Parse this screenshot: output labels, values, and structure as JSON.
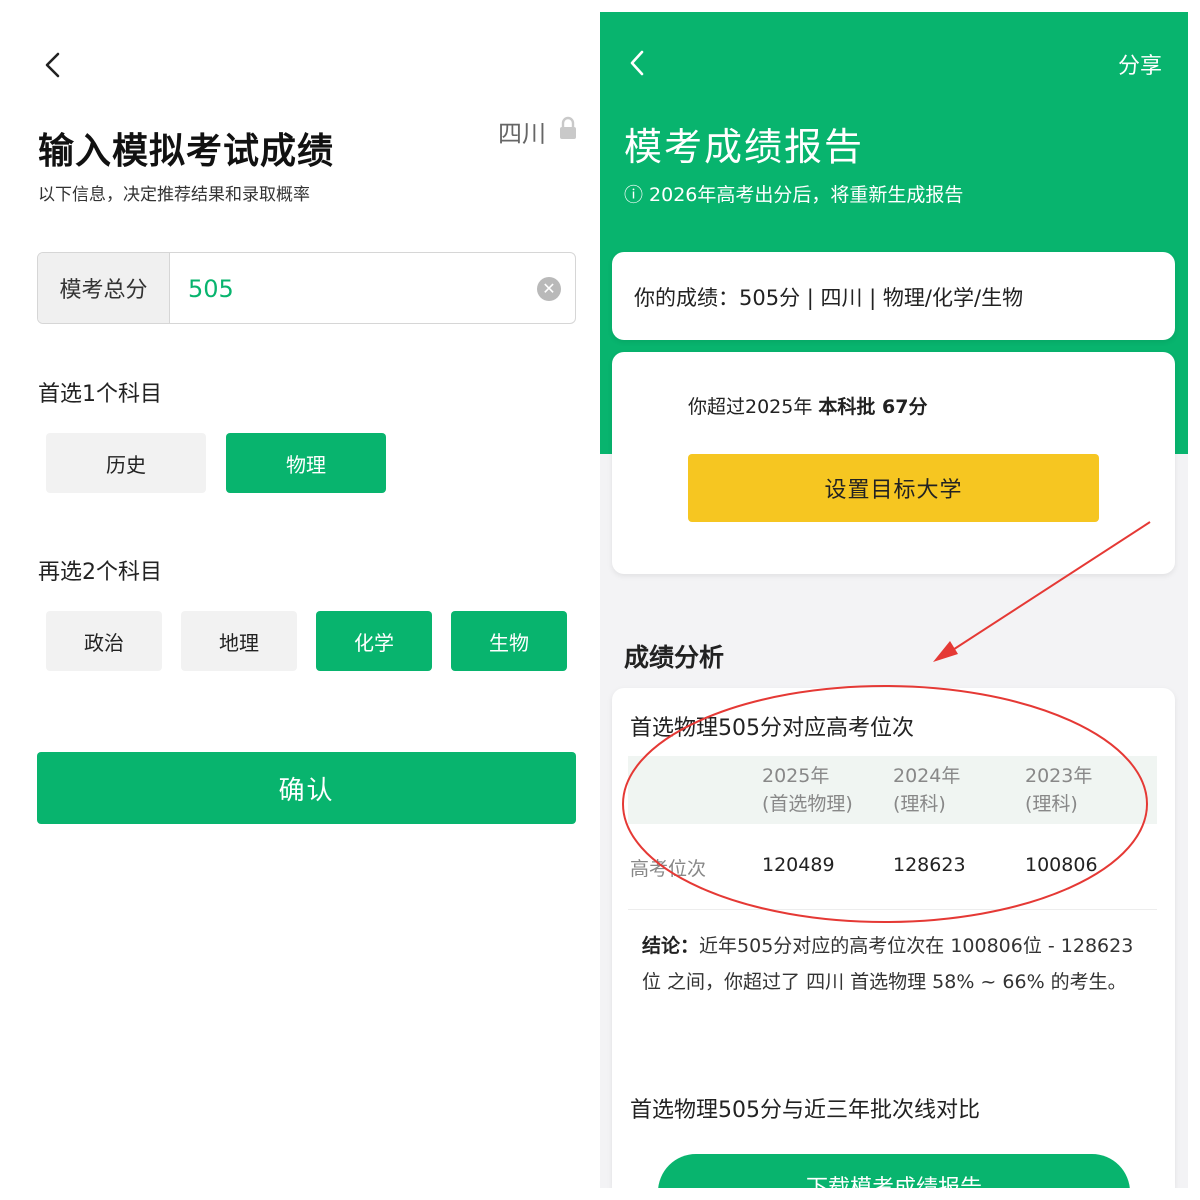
{
  "left": {
    "title": "输入模拟考试成绩",
    "province": "四川",
    "subtitle": "以下信息，决定推荐结果和录取概率",
    "score_label": "模考总分",
    "score_value": "505",
    "primary_label": "首选1个科目",
    "primary_options": [
      {
        "label": "历史",
        "selected": false
      },
      {
        "label": "物理",
        "selected": true
      }
    ],
    "secondary_label": "再选2个科目",
    "secondary_options": [
      {
        "label": "政治",
        "selected": false
      },
      {
        "label": "地理",
        "selected": false
      },
      {
        "label": "化学",
        "selected": true
      },
      {
        "label": "生物",
        "selected": true
      }
    ],
    "confirm_label": "确认"
  },
  "right": {
    "share_label": "分享",
    "title": "模考成绩报告",
    "note": "ⓘ 2026年高考出分后，将重新生成报告",
    "your_score": "你的成绩：505分 | 四川 | 物理/化学/生物",
    "exceed_prefix": "你超过2025年 ",
    "exceed_bold": "本科批 67分",
    "target_button": "设置目标大学",
    "analysis_title": "成绩分析",
    "rank_title": "首选物理505分对应高考位次",
    "rank_headers": [
      "2025年\n(首选物理)",
      "2024年\n(理科)",
      "2023年\n(理科)"
    ],
    "rank_row_label": "高考位次",
    "rank_values": [
      "120489",
      "128623",
      "100806"
    ],
    "conclusion_label": "结论：",
    "conclusion_text": "近年505分对应的高考位次在 100806位 - 128623位 之间，你超过了 四川 首选物理 58% ~ 66% 的考生。",
    "compare_title": "首选物理505分与近三年批次线对比",
    "download_label": "下载模考成绩报告"
  },
  "colors": {
    "brand_green": "#08b46e",
    "button_yellow": "#f6c621",
    "annotation_red": "#e53935"
  },
  "icons": [
    "back-arrow-icon",
    "lock-icon",
    "clear-icon",
    "info-icon"
  ]
}
